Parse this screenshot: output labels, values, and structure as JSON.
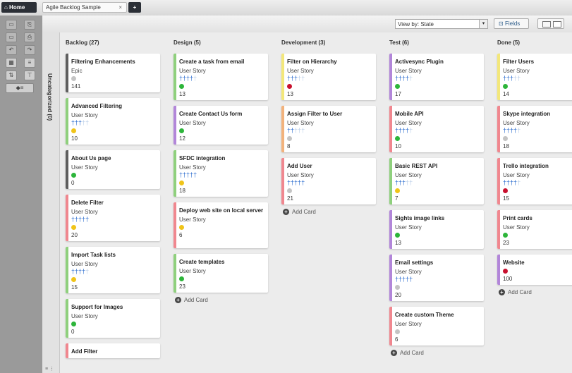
{
  "header": {
    "home_label": "⌂ Home",
    "tab_label": "Agile Backlog Sample",
    "tab_close": "×",
    "add_tab": "+"
  },
  "toolbar": {
    "view_by": "View by: State",
    "fields_label": "Fields"
  },
  "uncategorized": {
    "label": "Uncategorized (0)"
  },
  "colors": {
    "epic": "#5f5f5f",
    "green": "#8fd07d",
    "red": "#f0878f",
    "purple": "#b286d9",
    "yellow": "#f3e77a",
    "orange": "#f2b27c",
    "dot_green": "#2db53a",
    "dot_yellow": "#f0c419",
    "dot_red": "#c8102e",
    "dot_gray": "#c4c4c4"
  },
  "columns": [
    {
      "title": "Backlog (27)",
      "cards": [
        {
          "title": "Filtering Enhancements",
          "type": "Epic",
          "people": 0,
          "dot": "gray",
          "num": "141",
          "bar": "epic"
        },
        {
          "title": "Advanced Filtering",
          "type": "User Story",
          "people": 3,
          "dot": "yellow",
          "num": "10",
          "bar": "green"
        },
        {
          "title": "About Us page",
          "type": "User Story",
          "people": 0,
          "dot": "green",
          "num": "0",
          "bar": "epic"
        },
        {
          "title": "Delete Filter",
          "type": "User Story",
          "people": 5,
          "dot": "yellow",
          "num": "20",
          "bar": "red"
        },
        {
          "title": "Import Task lists",
          "type": "User Story",
          "people": 4,
          "dot": "yellow",
          "num": "15",
          "bar": "green"
        },
        {
          "title": "Support for Images",
          "type": "User Story",
          "people": 0,
          "dot": "green",
          "num": "0",
          "bar": "green"
        },
        {
          "title": "Add Filter",
          "type": "",
          "people": 0,
          "dot": "",
          "num": "",
          "bar": "red"
        }
      ]
    },
    {
      "title": "Design (5)",
      "cards": [
        {
          "title": "Create a task from email",
          "type": "User Story",
          "people": 4,
          "dot": "green",
          "num": "13",
          "bar": "green"
        },
        {
          "title": "Create Contact Us form",
          "type": "User Story",
          "people": 0,
          "dot": "green",
          "num": "12",
          "bar": "purple"
        },
        {
          "title": "SFDC integration",
          "type": "User Story",
          "people": 5,
          "dot": "yellow",
          "num": "18",
          "bar": "green"
        },
        {
          "title": "Deploy web site on local server",
          "type": "User Story",
          "people": 0,
          "dot": "yellow",
          "num": "6",
          "bar": "red"
        },
        {
          "title": "Create templates",
          "type": "User Story",
          "people": 0,
          "dot": "green",
          "num": "23",
          "bar": "green"
        }
      ],
      "add_card": "Add Card"
    },
    {
      "title": "Development (3)",
      "cards": [
        {
          "title": "Filter on Hierarchy",
          "type": "User Story",
          "people": 3,
          "dot": "red",
          "num": "13",
          "bar": "yellow"
        },
        {
          "title": "Assign Filter to User",
          "type": "User Story",
          "people": 2,
          "dot": "gray",
          "num": "8",
          "bar": "orange"
        },
        {
          "title": "Add User",
          "type": "User Story",
          "people": 5,
          "dot": "gray",
          "num": "21",
          "bar": "red"
        }
      ],
      "add_card": "Add Card"
    },
    {
      "title": "Test (6)",
      "cards": [
        {
          "title": "Activesync Plugin",
          "type": "User Story",
          "people": 4,
          "dot": "green",
          "num": "17",
          "bar": "purple"
        },
        {
          "title": "Mobile API",
          "type": "User Story",
          "people": 4,
          "dot": "green",
          "num": "10",
          "bar": "red"
        },
        {
          "title": "Basic REST API",
          "type": "User Story",
          "people": 3,
          "dot": "yellow",
          "num": "7",
          "bar": "green"
        },
        {
          "title": "Sights image links",
          "type": "User Story",
          "people": 0,
          "dot": "green",
          "num": "13",
          "bar": "purple"
        },
        {
          "title": "Email settings",
          "type": "User Story",
          "people": 5,
          "dot": "gray",
          "num": "20",
          "bar": "purple"
        },
        {
          "title": "Create custom Theme",
          "type": "User Story",
          "people": 0,
          "dot": "gray",
          "num": "6",
          "bar": "red"
        }
      ],
      "add_card": "Add Card"
    },
    {
      "title": "Done (5)",
      "cards": [
        {
          "title": "Filter Users",
          "type": "User Story",
          "people": 3,
          "dot": "green",
          "num": "14",
          "bar": "yellow"
        },
        {
          "title": "Skype integration",
          "type": "User Story",
          "people": 4,
          "dot": "gray",
          "num": "18",
          "bar": "red"
        },
        {
          "title": "Trello integration",
          "type": "User Story",
          "people": 4,
          "dot": "red",
          "num": "15",
          "bar": "red"
        },
        {
          "title": "Print cards",
          "type": "User Story",
          "people": 0,
          "dot": "green",
          "num": "23",
          "bar": "red"
        },
        {
          "title": "Website",
          "type": "",
          "people": 0,
          "dot": "red",
          "num": "100",
          "bar": "purple"
        }
      ],
      "add_card": "Add Card"
    }
  ]
}
